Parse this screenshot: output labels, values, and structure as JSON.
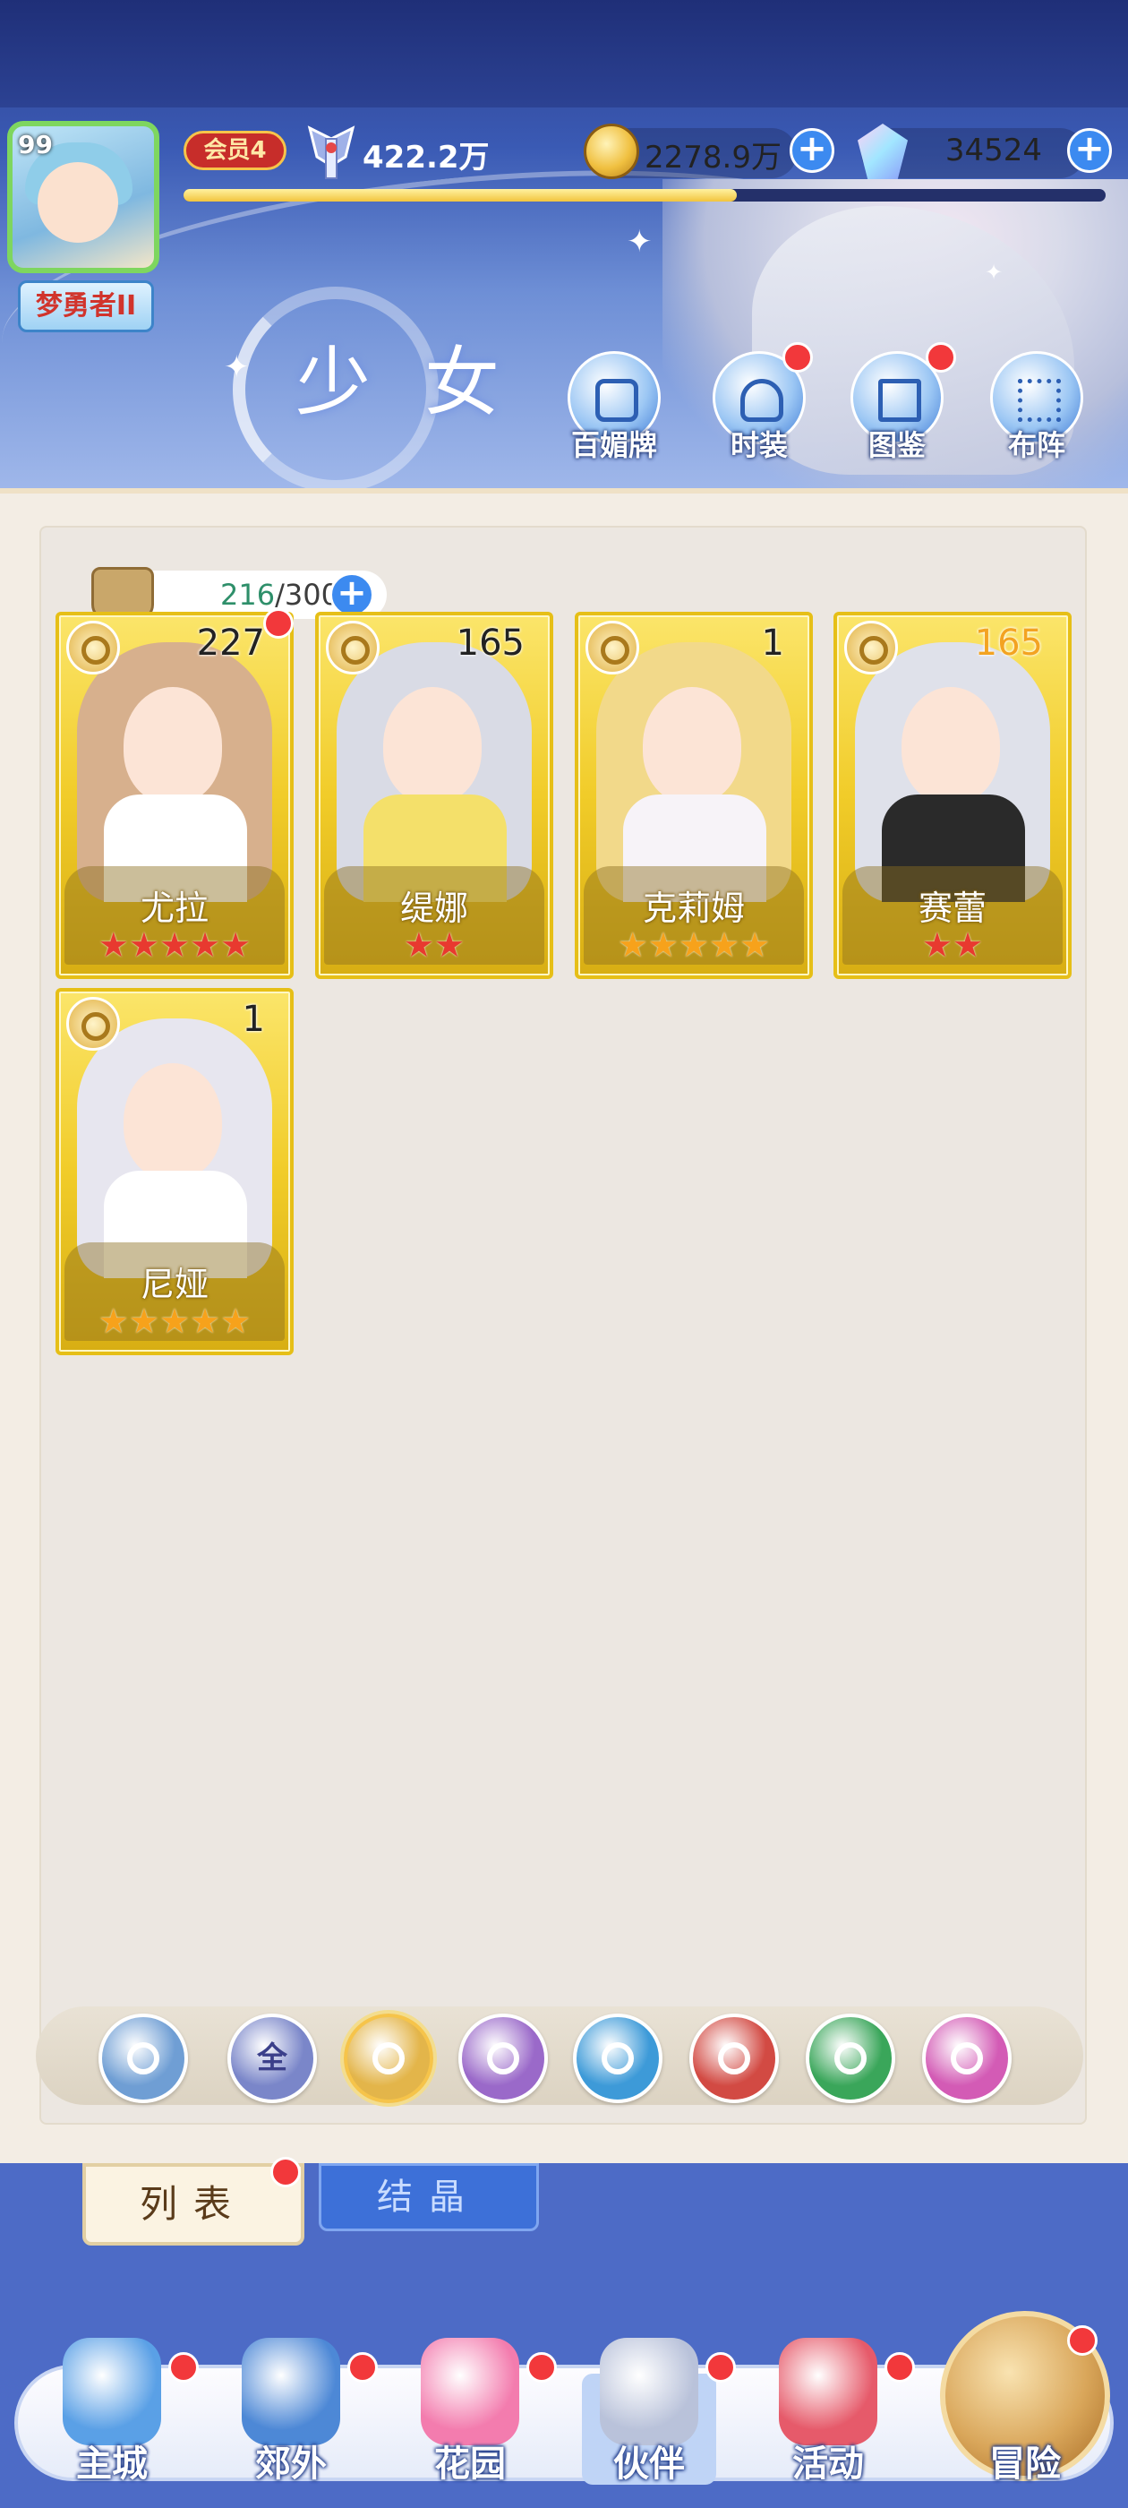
{
  "header": {
    "level": "99",
    "player_title": "梦勇者II",
    "vip": "会员4",
    "power": "422.2万",
    "gold": "2278.9万",
    "gems": "34524",
    "exp_progress": 0.6,
    "page_title": "少女"
  },
  "nav_buttons": [
    {
      "label": "百媚牌",
      "icon": "hexagram-card-icon",
      "badge": false
    },
    {
      "label": "时装",
      "icon": "costume-icon",
      "badge": true
    },
    {
      "label": "图鉴",
      "icon": "gallery-book-icon",
      "badge": true
    },
    {
      "label": "布阵",
      "icon": "formation-grid-icon",
      "badge": false
    }
  ],
  "capacity": {
    "current": "216",
    "max": "300"
  },
  "cards": [
    {
      "name": "尤拉",
      "level": "227",
      "stars": 5,
      "star_color": "red",
      "badge": true,
      "hair": "#d7b08d",
      "outfit": "#ffffff"
    },
    {
      "name": "缇娜",
      "level": "165",
      "stars": 2,
      "star_color": "red",
      "badge": false,
      "hair": "#d9dbe5",
      "outfit": "#f4e06a"
    },
    {
      "name": "克莉姆",
      "level": "1",
      "stars": 5,
      "star_color": "gold",
      "badge": false,
      "hair": "#f2d98a",
      "outfit": "#f7f3f8"
    },
    {
      "name": "赛蕾",
      "level": "165",
      "stars": 2,
      "star_color": "red",
      "badge": false,
      "hair": "#dfe1ea",
      "outfit": "#2a2a2a",
      "level_color": "#f3a321"
    },
    {
      "name": "尼娅",
      "level": "1",
      "stars": 5,
      "star_color": "gold",
      "badge": false,
      "hair": "#e7e6ef",
      "outfit": "#ffffff"
    }
  ],
  "filters": [
    {
      "name": "wind-element-filter",
      "label": "",
      "color": "#6f9ed4"
    },
    {
      "name": "all-filter",
      "label": "全",
      "color": "#7a86c9"
    },
    {
      "name": "light-element-filter",
      "label": "",
      "color": "#e3b54a",
      "selected": true
    },
    {
      "name": "moon-element-filter",
      "label": "",
      "color": "#9a69c9"
    },
    {
      "name": "water-element-filter",
      "label": "",
      "color": "#3d9ad8"
    },
    {
      "name": "fire-element-filter",
      "label": "",
      "color": "#d24a43"
    },
    {
      "name": "nature-element-filter",
      "label": "",
      "color": "#3aa65a"
    },
    {
      "name": "dark-element-filter",
      "label": "",
      "color": "#d35bb5"
    }
  ],
  "tabs": {
    "list": "列表",
    "crystal": "结晶"
  },
  "bottom_nav": [
    {
      "label": "主城",
      "icon": "castle-icon",
      "badge": true
    },
    {
      "label": "郊外",
      "icon": "portal-icon",
      "badge": true
    },
    {
      "label": "花园",
      "icon": "heart-garden-icon",
      "badge": true
    },
    {
      "label": "伙伴",
      "icon": "partner-avatar-icon",
      "badge": true,
      "active": true
    },
    {
      "label": "活动",
      "icon": "gift-box-icon",
      "badge": true
    },
    {
      "label": "冒险",
      "icon": "compass-icon",
      "badge": true
    }
  ]
}
